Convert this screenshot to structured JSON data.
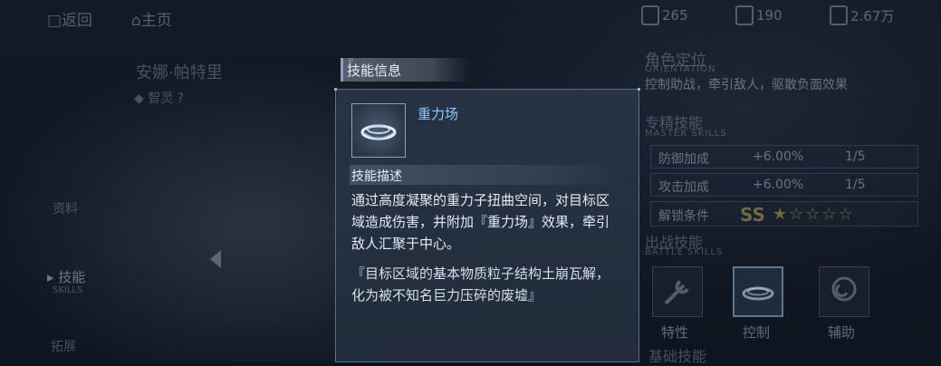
{
  "topbar": {
    "back_label": "□返回",
    "home_label": "⌂主页",
    "resources": [
      {
        "icon": "battery-icon",
        "value": "265"
      },
      {
        "icon": "cube-icon",
        "value": "190"
      },
      {
        "icon": "credit-icon",
        "value": "2.67万"
      }
    ]
  },
  "character": {
    "name": "安娜·帕特里",
    "subtitle": "◆ 智灵 ?"
  },
  "sidebar": {
    "item1": "资料",
    "item2": "▸ 技能",
    "item2_en": "SKILLS",
    "item3": "拓展"
  },
  "right_panel": {
    "role_title": "角色定位",
    "role_title_en": "ORIENTATION",
    "role_desc": "控制助战，牵引敌人，驱散负面效果",
    "mastery_title": "专精技能",
    "mastery_title_en": "MASTER SKILLS",
    "stats": [
      {
        "name": "防御加成",
        "value": "+6.00%",
        "level": "1/5"
      },
      {
        "name": "攻击加成",
        "value": "+6.00%",
        "level": "1/5"
      }
    ],
    "unlock_label": "解锁条件",
    "unlock_rank": "SS",
    "unlock_stars": "★☆☆☆☆",
    "battle_title": "出战技能",
    "battle_title_en": "BATTLE SKILLS",
    "slots": [
      "特性",
      "控制",
      "辅助"
    ],
    "bottom_title": "基础技能"
  },
  "modal": {
    "tab_title": "技能信息",
    "tab_corner": "『",
    "skill_name": "重力场",
    "desc_heading": "技能描述",
    "desc_lines": [
      "通过高度凝聚的重力子扭曲空间，对目标区",
      "域造成伤害，并附加『重力场』效果，牵引",
      "敌人汇聚于中心。"
    ],
    "lore_lines": [
      "『目标区域的基本物质粒子结构土崩瓦解，",
      "化为被不知名巨力压碎的废墟』"
    ]
  }
}
